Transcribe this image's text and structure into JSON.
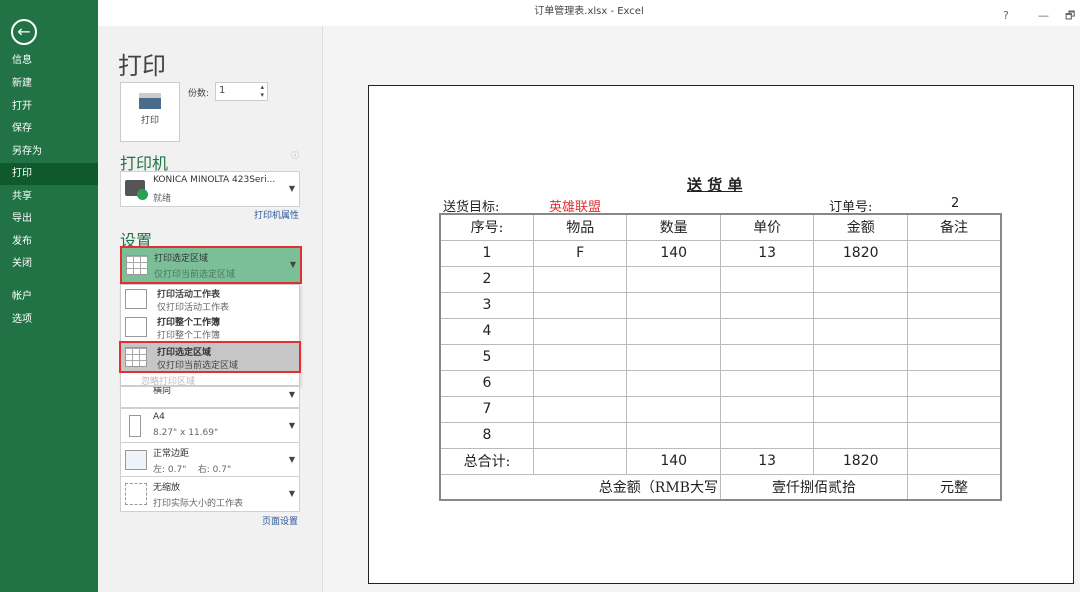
{
  "window": {
    "title": "订单管理表.xlsx - Excel",
    "help": "?",
    "minimize": "—",
    "restore": "🗗"
  },
  "sidebar": {
    "items": [
      "信息",
      "新建",
      "打开",
      "保存",
      "另存为",
      "打印",
      "共享",
      "导出",
      "发布",
      "关闭",
      "帐户",
      "选项"
    ],
    "active": "打印"
  },
  "panel": {
    "title": "打印",
    "print_button": "打印",
    "copies_label": "份数:",
    "copies_value": "1",
    "printer_heading": "打印机",
    "printer_name": "KONICA MINOLTA 423Seri...",
    "printer_status": "就绪",
    "printer_properties": "打印机属性",
    "settings_heading": "设置",
    "selected": {
      "title": "打印选定区域",
      "desc": "仅打印当前选定区域"
    },
    "menu": [
      {
        "title": "打印活动工作表",
        "desc": "仅打印活动工作表"
      },
      {
        "title": "打印整个工作簿",
        "desc": "打印整个工作簿"
      },
      {
        "title": "打印选定区域",
        "desc": "仅打印当前选定区域"
      }
    ],
    "ignore_print_area": "忽略打印区域",
    "orientation": "横向",
    "paper": {
      "title": "A4",
      "desc": "8.27\" x 11.69\""
    },
    "margins": {
      "title": "正常边距",
      "desc": "左: 0.7\"    右: 0.7\""
    },
    "scaling": {
      "title": "无缩放",
      "desc": "打印实际大小的工作表"
    },
    "page_setup": "页面设置"
  },
  "preview": {
    "title": "送 货 单",
    "target_label": "送货目标:",
    "target_value": "英雄联盟",
    "order_label": "订单号:",
    "order_value": "2",
    "headers": [
      "序号:",
      "物品",
      "数量",
      "单价",
      "金额",
      "备注"
    ],
    "rows": [
      [
        "1",
        "F",
        "140",
        "13",
        "1820",
        ""
      ],
      [
        "2",
        "",
        "",
        "",
        "",
        ""
      ],
      [
        "3",
        "",
        "",
        "",
        "",
        ""
      ],
      [
        "4",
        "",
        "",
        "",
        "",
        ""
      ],
      [
        "5",
        "",
        "",
        "",
        "",
        ""
      ],
      [
        "6",
        "",
        "",
        "",
        "",
        ""
      ],
      [
        "7",
        "",
        "",
        "",
        "",
        ""
      ],
      [
        "8",
        "",
        "",
        "",
        "",
        ""
      ]
    ],
    "total": [
      "总合计:",
      "",
      "140",
      "13",
      "1820",
      ""
    ],
    "amount_label": "总金额（RMB大写",
    "amount_value": "壹仟捌佰贰拾",
    "amount_unit": "元整"
  },
  "colors": {
    "brand": "#217346",
    "highlight": "#e03030",
    "target_text": "#e03030"
  }
}
